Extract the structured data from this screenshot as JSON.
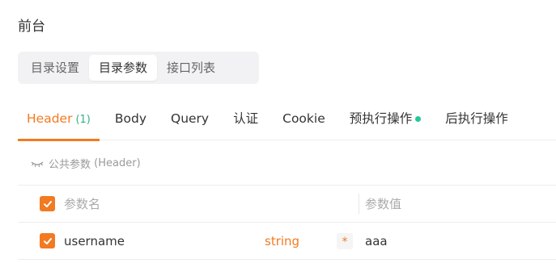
{
  "page_title": "前台",
  "segmented_tabs": [
    {
      "label": "目录设置",
      "active": false
    },
    {
      "label": "目录参数",
      "active": true
    },
    {
      "label": "接口列表",
      "active": false
    }
  ],
  "param_tabs": {
    "header_label": "Header",
    "header_count": "(1)",
    "body_label": "Body",
    "query_label": "Query",
    "auth_label": "认证",
    "cookie_label": "Cookie",
    "pre_label": "预执行操作",
    "post_label": "后执行操作"
  },
  "shared_params": {
    "icon": "eye-closed-icon",
    "label": "公共参数",
    "suffix": "(Header)"
  },
  "table": {
    "headers": {
      "name": "参数名",
      "value": "参数值"
    },
    "rows": [
      {
        "name": "username",
        "type": "string",
        "required": "*",
        "value": "aaa",
        "checked": true
      }
    ]
  },
  "colors": {
    "accent": "#f27a21",
    "dot": "#20c997",
    "count": "#34b37e"
  }
}
